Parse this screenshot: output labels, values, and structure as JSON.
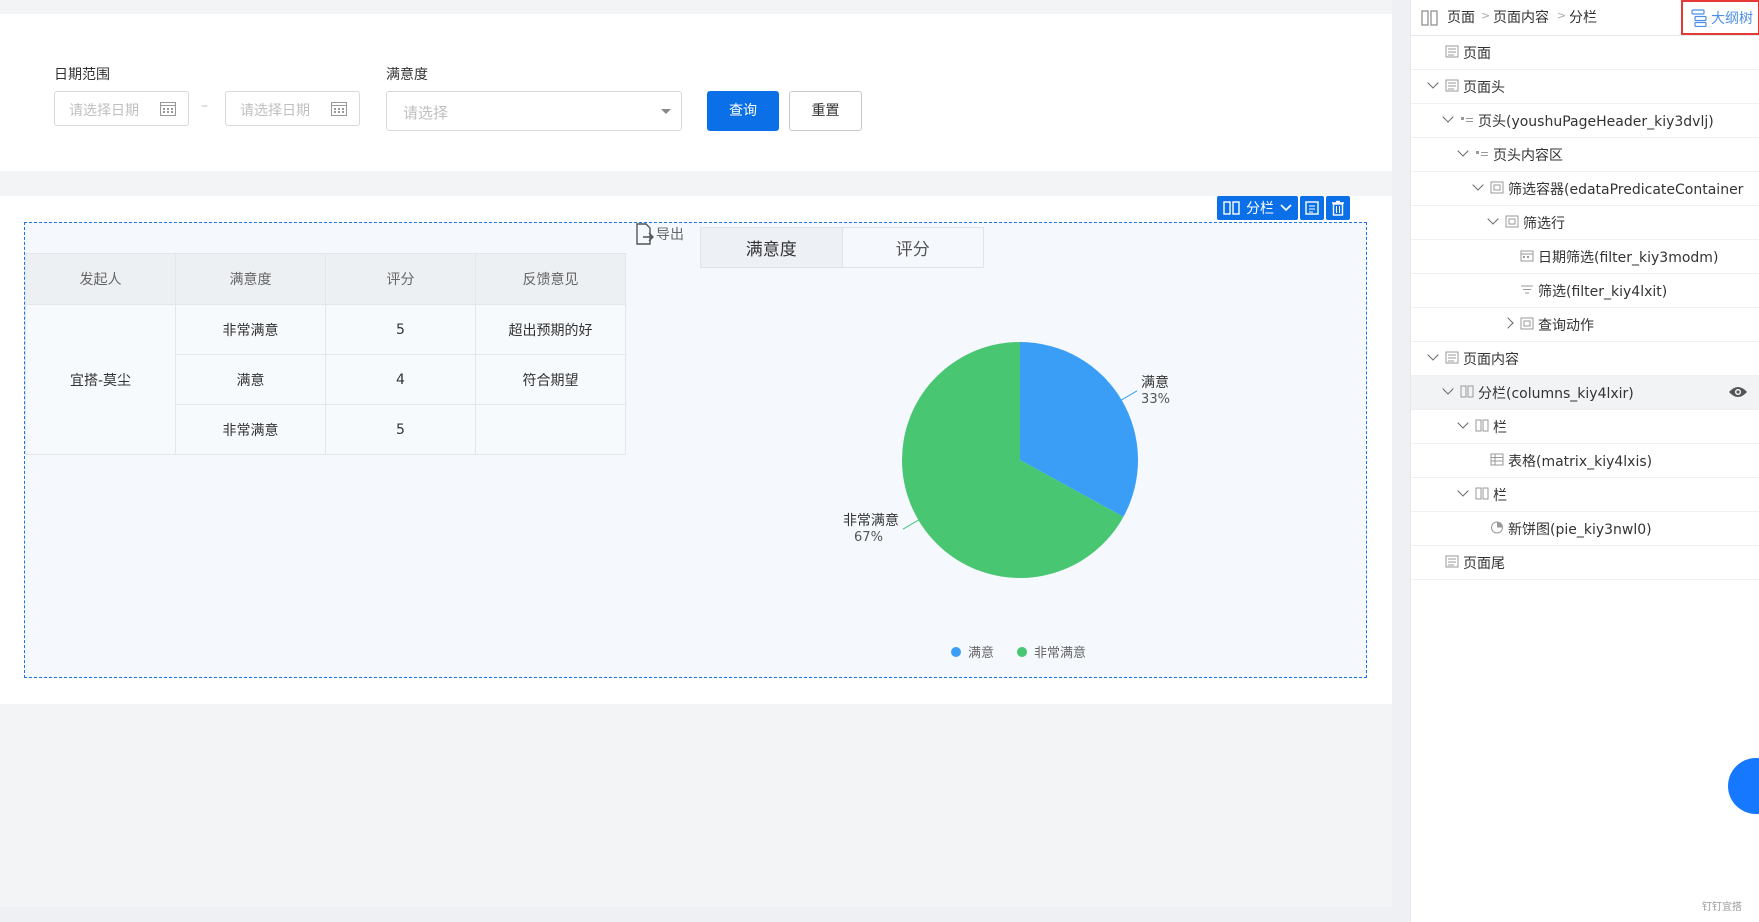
{
  "filters": {
    "date_range_label": "日期范围",
    "start_date_placeholder": "请选择日期",
    "range_separator": "–",
    "end_date_placeholder": "请选择日期",
    "satisfaction_label": "满意度",
    "satisfaction_placeholder": "请选择",
    "query_button": "查询",
    "reset_button": "重置"
  },
  "columns_toolbar": {
    "label": "分栏"
  },
  "table": {
    "headers": [
      "发起人",
      "满意度",
      "评分",
      "反馈意见"
    ],
    "initiator": "宜搭-莫尘",
    "rows": [
      {
        "satisfaction": "非常满意",
        "score": "5",
        "feedback": "超出预期的好"
      },
      {
        "satisfaction": "满意",
        "score": "4",
        "feedback": "符合期望"
      },
      {
        "satisfaction": "非常满意",
        "score": "5",
        "feedback": ""
      }
    ]
  },
  "export_label": "导出",
  "chart_tabs": [
    "满意度",
    "评分"
  ],
  "chart_data": {
    "type": "pie",
    "slices": [
      {
        "label": "满意",
        "value": 33,
        "percent_label": "33%",
        "color": "#3a9ef7"
      },
      {
        "label": "非常满意",
        "value": 67,
        "percent_label": "67%",
        "color": "#48c672"
      }
    ],
    "legend": [
      "满意",
      "非常满意"
    ],
    "legend_position": "bottom"
  },
  "outline": {
    "breadcrumb": [
      "页面",
      "页面内容",
      "分栏"
    ],
    "breadcrumb_sep": ">",
    "outline_button": "大纲树",
    "nodes": [
      {
        "label": "页面",
        "icon": "page-icon"
      },
      {
        "label": "页面头",
        "icon": "page-icon"
      },
      {
        "label": "页头(youshuPageHeader_kiy3dvlj)",
        "icon": "header-icon"
      },
      {
        "label": "页头内容区",
        "icon": "header-icon"
      },
      {
        "label": "筛选容器(edataPredicateContainer",
        "icon": "container-icon"
      },
      {
        "label": "筛选行",
        "icon": "container-icon"
      },
      {
        "label": "日期筛选(filter_kiy3modm)",
        "icon": "calendar-icon"
      },
      {
        "label": "筛选(filter_kiy4lxit)",
        "icon": "filter-icon"
      },
      {
        "label": "查询动作",
        "icon": "container-icon"
      },
      {
        "label": "页面内容",
        "icon": "page-icon"
      },
      {
        "label": "分栏(columns_kiy4lxir)",
        "icon": "columns-icon"
      },
      {
        "label": "栏",
        "icon": "columns-icon"
      },
      {
        "label": "表格(matrix_kiy4lxis)",
        "icon": "table-icon"
      },
      {
        "label": "栏",
        "icon": "columns-icon"
      },
      {
        "label": "新饼图(pie_kiy3nwl0)",
        "icon": "pie-icon"
      },
      {
        "label": "页面尾",
        "icon": "page-icon"
      }
    ]
  },
  "watermark": "钉钉宜搭",
  "colors": {
    "primary": "#0b6fe8",
    "pie_blue": "#3a9ef7",
    "pie_green": "#48c672",
    "highlight_border": "#e53935"
  }
}
